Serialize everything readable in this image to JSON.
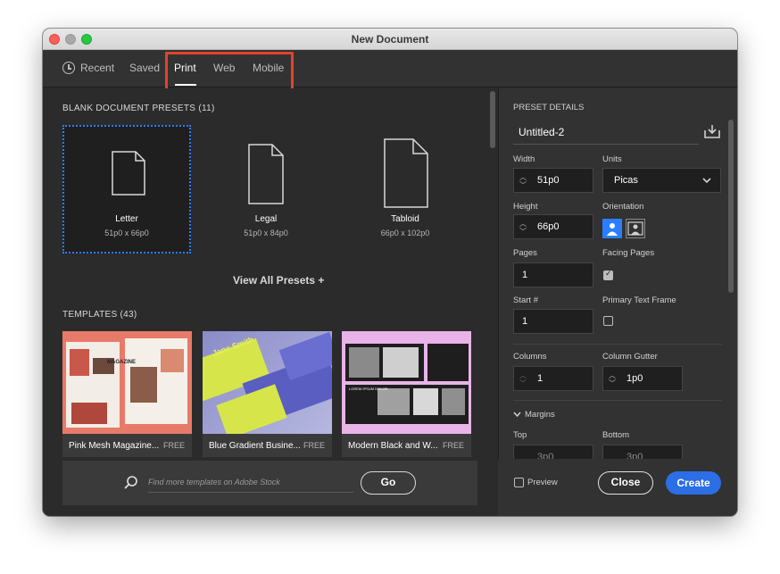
{
  "window": {
    "title": "New Document"
  },
  "tabs": [
    {
      "label": "Recent"
    },
    {
      "label": "Saved"
    },
    {
      "label": "Print"
    },
    {
      "label": "Web"
    },
    {
      "label": "Mobile"
    }
  ],
  "presets": {
    "heading": "BLANK DOCUMENT PRESETS",
    "count": "(11)",
    "items": [
      {
        "name": "Letter",
        "size": "51p0 x 66p0"
      },
      {
        "name": "Legal",
        "size": "51p0 x 84p0"
      },
      {
        "name": "Tabloid",
        "size": "66p0 x 102p0"
      }
    ],
    "view_all": "View All Presets +"
  },
  "templates": {
    "heading": "TEMPLATES",
    "count": "(43)",
    "items": [
      {
        "name": "Pink Mesh Magazine...",
        "badge": "FREE",
        "thumb_text": "MAGAZINE"
      },
      {
        "name": "Blue Gradient Busine...",
        "badge": "FREE",
        "thumb_text": "Jane Smith"
      },
      {
        "name": "Modern Black and W...",
        "badge": "FREE",
        "thumb_text": "LOREM IPSUM DOLOR"
      }
    ]
  },
  "stock": {
    "placeholder": "Find more templates on Adobe Stock",
    "go_label": "Go"
  },
  "details": {
    "heading": "PRESET DETAILS",
    "doc_name": "Untitled-2",
    "width_label": "Width",
    "width_value": "51p0",
    "units_label": "Units",
    "units_value": "Picas",
    "height_label": "Height",
    "height_value": "66p0",
    "orientation_label": "Orientation",
    "pages_label": "Pages",
    "pages_value": "1",
    "facing_label": "Facing Pages",
    "facing_checked": true,
    "start_label": "Start #",
    "start_value": "1",
    "primary_label": "Primary Text Frame",
    "primary_checked": false,
    "columns_label": "Columns",
    "columns_value": "1",
    "gutter_label": "Column Gutter",
    "gutter_value": "1p0",
    "margins_label": "Margins",
    "top_label": "Top",
    "bottom_label": "Bottom",
    "top_value": "3p0",
    "bottom_value": "3p0"
  },
  "footer": {
    "preview_label": "Preview",
    "close_label": "Close",
    "create_label": "Create"
  },
  "colors": {
    "accent": "#2b6ee6",
    "highlight": "#e0442c",
    "background": "#2b2b2b"
  }
}
